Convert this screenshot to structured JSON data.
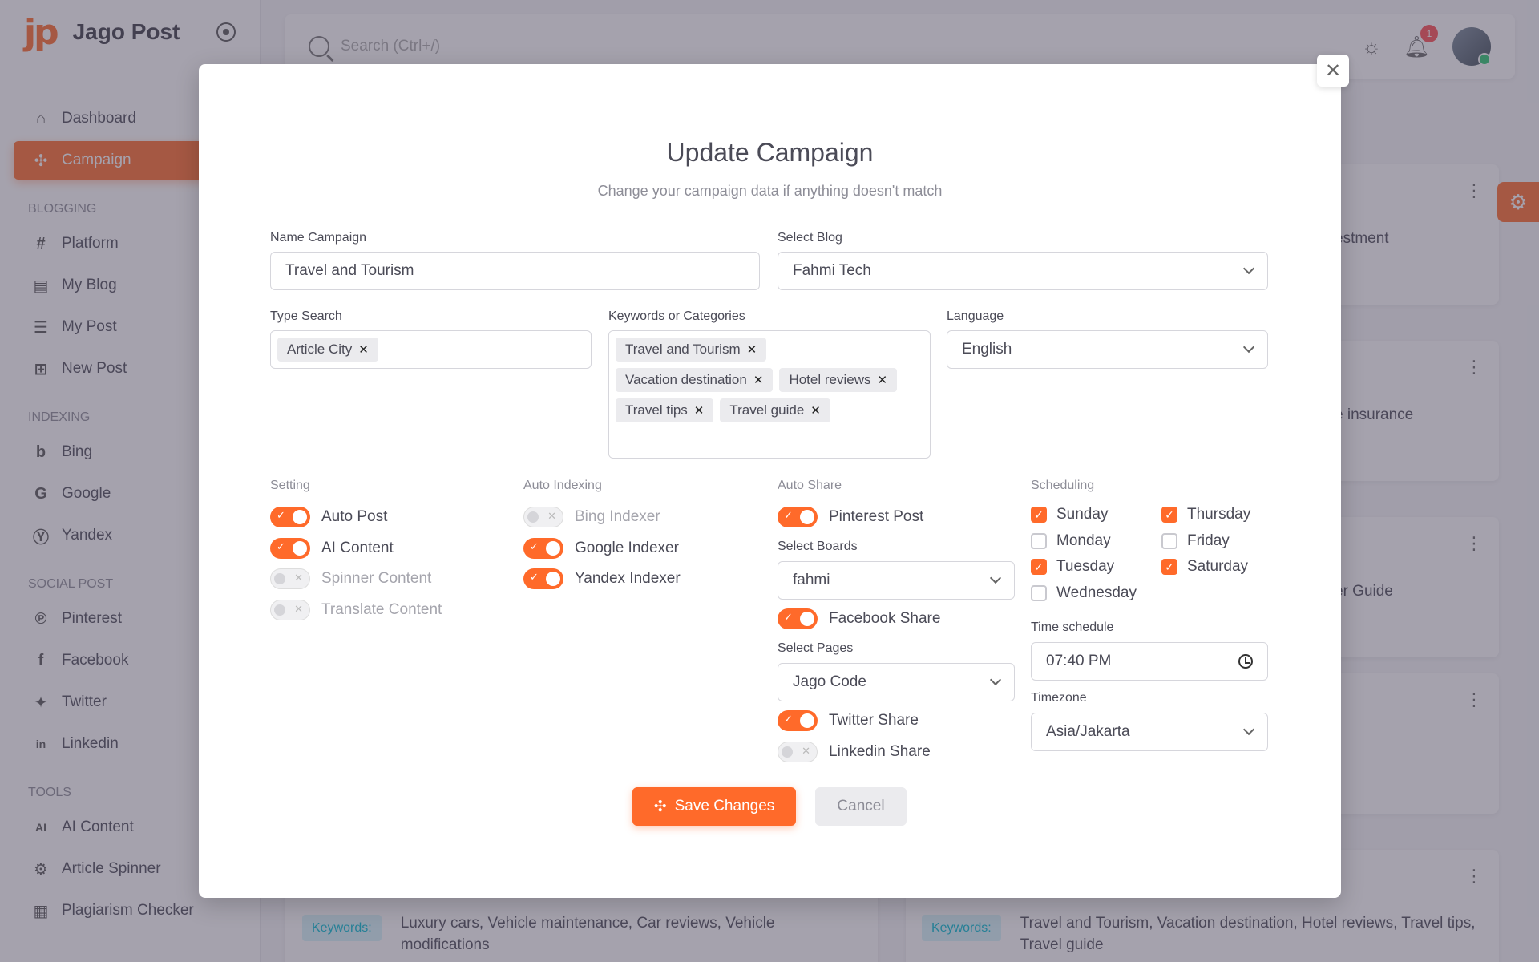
{
  "brand": {
    "logo": "jp",
    "name": "Jago Post"
  },
  "sidebar": {
    "main": [
      {
        "label": "Dashboard",
        "icon": "home-icon"
      },
      {
        "label": "Campaign",
        "icon": "campaign-icon",
        "active": true
      }
    ],
    "sections": [
      {
        "title": "BLOGGING",
        "items": [
          {
            "label": "Platform",
            "glyph": "#"
          },
          {
            "label": "My Blog",
            "glyph": "▤"
          },
          {
            "label": "My Post",
            "glyph": "☰"
          },
          {
            "label": "New Post",
            "glyph": "⊞"
          }
        ]
      },
      {
        "title": "INDEXING",
        "items": [
          {
            "label": "Bing",
            "glyph": "b"
          },
          {
            "label": "Google",
            "glyph": "G"
          },
          {
            "label": "Yandex",
            "glyph": "Ⓨ"
          }
        ]
      },
      {
        "title": "SOCIAL POST",
        "items": [
          {
            "label": "Pinterest",
            "glyph": "℗"
          },
          {
            "label": "Facebook",
            "glyph": "f"
          },
          {
            "label": "Twitter",
            "glyph": "✦"
          },
          {
            "label": "Linkedin",
            "glyph": "in"
          }
        ]
      },
      {
        "title": "TOOLS",
        "items": [
          {
            "label": "AI Content",
            "glyph": "AI"
          },
          {
            "label": "Article Spinner",
            "glyph": "⚙"
          },
          {
            "label": "Plagiarism Checker",
            "glyph": "▦"
          }
        ]
      }
    ]
  },
  "topbar": {
    "search_placeholder": "Search (Ctrl+/)",
    "notification_count": "1"
  },
  "background": {
    "card_snippets": [
      "estment",
      "e insurance",
      "er Guide"
    ],
    "keywords_label": "Keywords:",
    "keywords_left": "Luxury cars, Vehicle maintenance, Car reviews, Vehicle modifications",
    "keywords_right": "Travel and Tourism, Vacation destination, Hotel reviews, Travel tips, Travel guide"
  },
  "modal": {
    "title": "Update Campaign",
    "subtitle": "Change your campaign data if anything doesn't match",
    "name_label": "Name Campaign",
    "name_value": "Travel and Tourism",
    "blog_label": "Select Blog",
    "blog_value": "Fahmi Tech",
    "type_label": "Type Search",
    "type_tags": [
      "Article City"
    ],
    "keywords_label": "Keywords or Categories",
    "keyword_tags": [
      "Travel and Tourism",
      "Vacation destination",
      "Hotel reviews",
      "Travel tips",
      "Travel guide"
    ],
    "language_label": "Language",
    "language_value": "English",
    "setting": {
      "title": "Setting",
      "items": [
        {
          "label": "Auto Post",
          "on": true
        },
        {
          "label": "AI Content",
          "on": true
        },
        {
          "label": "Spinner Content",
          "on": false
        },
        {
          "label": "Translate Content",
          "on": false
        }
      ]
    },
    "indexing": {
      "title": "Auto Indexing",
      "items": [
        {
          "label": "Bing Indexer",
          "on": false
        },
        {
          "label": "Google Indexer",
          "on": true
        },
        {
          "label": "Yandex Indexer",
          "on": true
        }
      ]
    },
    "share": {
      "title": "Auto Share",
      "pinterest": "Pinterest Post",
      "boards_label": "Select Boards",
      "boards_value": "fahmi",
      "facebook": "Facebook Share",
      "pages_label": "Select Pages",
      "pages_value": "Jago Code",
      "twitter": "Twitter Share",
      "linkedin": "Linkedin Share"
    },
    "scheduling": {
      "title": "Scheduling",
      "days": [
        {
          "label": "Sunday",
          "on": true
        },
        {
          "label": "Monday",
          "on": false
        },
        {
          "label": "Tuesday",
          "on": true
        },
        {
          "label": "Wednesday",
          "on": false
        },
        {
          "label": "Thursday",
          "on": true
        },
        {
          "label": "Friday",
          "on": false
        },
        {
          "label": "Saturday",
          "on": true
        }
      ],
      "time_label": "Time schedule",
      "time_value": "07:40 PM",
      "tz_label": "Timezone",
      "tz_value": "Asia/Jakarta"
    },
    "save_label": "Save Changes",
    "cancel_label": "Cancel"
  },
  "colors": {
    "accent": "#ff6a2a",
    "overlay": "#4b465c"
  }
}
